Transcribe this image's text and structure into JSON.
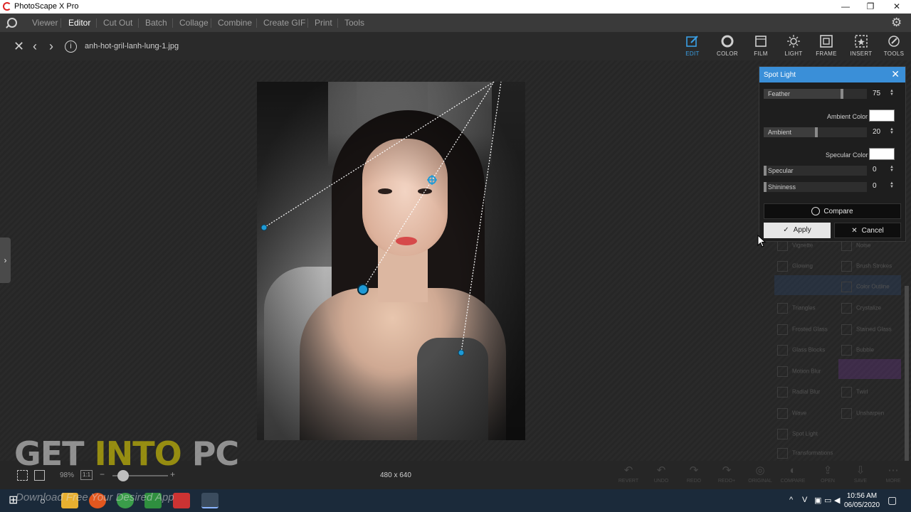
{
  "window": {
    "title": "PhotoScape X Pro",
    "minimize": "—",
    "maximize": "❐",
    "close": "✕"
  },
  "menu": {
    "items": [
      "Viewer",
      "Editor",
      "Cut Out",
      "Batch",
      "Collage",
      "Combine",
      "Create GIF",
      "Print",
      "Tools"
    ],
    "active": "Editor",
    "settings_icon": "gear-icon"
  },
  "file": {
    "name": "anh-hot-gril-lanh-lung-1.jpg"
  },
  "tool_tabs": [
    {
      "label": "EDIT",
      "icon": "edit-icon",
      "active": true
    },
    {
      "label": "COLOR",
      "icon": "color-icon",
      "active": false
    },
    {
      "label": "FILM",
      "icon": "film-icon",
      "active": false
    },
    {
      "label": "LIGHT",
      "icon": "light-icon",
      "active": false
    },
    {
      "label": "FRAME",
      "icon": "frame-icon",
      "active": false
    },
    {
      "label": "INSERT",
      "icon": "insert-icon",
      "active": false
    },
    {
      "label": "TOOLS",
      "icon": "tools-icon",
      "active": false
    }
  ],
  "panel": {
    "title": "Spot Light",
    "feather": {
      "label": "Feather",
      "value": "75"
    },
    "ambient_color": {
      "label": "Ambient Color",
      "color": "#ffffff"
    },
    "ambient": {
      "label": "Ambient",
      "value": "20"
    },
    "specular_color": {
      "label": "Specular Color",
      "color": "#ffffff"
    },
    "specular": {
      "label": "Specular",
      "value": "0"
    },
    "shininess": {
      "label": "Shininess",
      "value": "0"
    },
    "compare_label": "Compare",
    "apply_label": "Apply",
    "cancel_label": "Cancel"
  },
  "ghost_filters": [
    "Vignette",
    "Noise",
    "Glowing",
    "Brush Strokes",
    "Color Outline",
    "Triangles",
    "Crystalize",
    "Frosted Glass",
    "Stained Glass",
    "Glass Blocks",
    "Bubble",
    "Motion Blur",
    "Radial Blur",
    "Twirl",
    "Wave",
    "Unsharpen",
    "Spot Light",
    "Transformations"
  ],
  "status": {
    "dimensions": "480 x 640",
    "zoom": "98%",
    "one_to_one": "1:1",
    "zoom_minus": "−",
    "zoom_plus": "+"
  },
  "actions": [
    "REVERT",
    "UNDO",
    "REDO",
    "REDO+",
    "ORIGINAL",
    "COMPARE",
    "OPEN",
    "SAVE",
    "MORE"
  ],
  "watermark": {
    "part1": "GET ",
    "part2": "INTO",
    "part3": " PC",
    "tagline": "Download Free Your Desired App"
  },
  "taskbar": {
    "time": "10:56 AM",
    "date": "06/05/2020"
  },
  "colors": {
    "accent": "#3aa0e6",
    "panel_header": "#3a8fd8",
    "handle": "#1e9ad6"
  }
}
